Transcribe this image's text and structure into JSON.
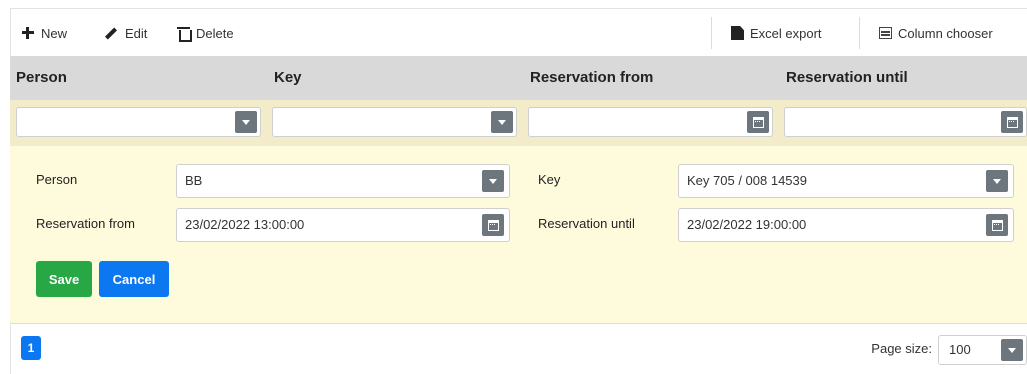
{
  "toolbar": {
    "new_label": "New",
    "edit_label": "Edit",
    "delete_label": "Delete",
    "excel_label": "Excel export",
    "columns_label": "Column chooser"
  },
  "columns": [
    "Person",
    "Key",
    "Reservation from",
    "Reservation until"
  ],
  "filters": [
    "",
    "",
    "",
    ""
  ],
  "form": {
    "person_label": "Person",
    "person_value": "BB",
    "key_label": "Key",
    "key_value": "Key 705 / 008 14539",
    "from_label": "Reservation from",
    "from_value": "23/02/2022 13:00:00",
    "until_label": "Reservation until",
    "until_value": "23/02/2022 19:00:00",
    "save_label": "Save",
    "cancel_label": "Cancel"
  },
  "pager": {
    "current_page": "1",
    "page_size_label": "Page size:",
    "page_size_value": "100"
  },
  "colors": {
    "header_bg": "#d9d9d9",
    "filter_bg": "#f2eccb",
    "form_bg": "#fdfbdc",
    "save": "#28a745",
    "primary": "#0b78f2"
  }
}
